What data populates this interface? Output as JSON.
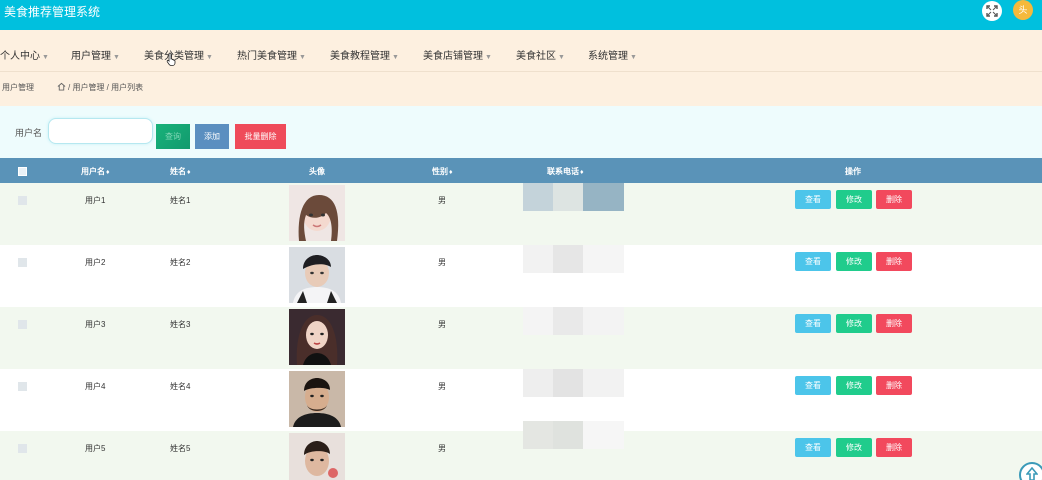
{
  "app": {
    "title": "美食推荐管理系统",
    "avatar_text": "头"
  },
  "nav": {
    "items": [
      {
        "label": "个人中心"
      },
      {
        "label": "用户管理"
      },
      {
        "label": "美食分类管理"
      },
      {
        "label": "热门美食管理"
      },
      {
        "label": "美食教程管理"
      },
      {
        "label": "美食店铺管理"
      },
      {
        "label": "美食社区"
      },
      {
        "label": "系统管理"
      }
    ]
  },
  "breadcrumb": {
    "title": "用户管理",
    "path": "/ 用户管理 / 用户列表"
  },
  "search": {
    "label": "用户名",
    "value": "",
    "placeholder": "",
    "search_button": "查询",
    "add_button": "添加",
    "batch_delete_button": "批量删除"
  },
  "table": {
    "columns": [
      "用户名",
      "姓名",
      "头像",
      "性别",
      "联系电话",
      "操作"
    ],
    "sort_icon": "♦",
    "actions": {
      "view": "查看",
      "edit": "修改",
      "delete": "删除"
    },
    "rows": [
      {
        "username": "用户1",
        "name": "姓名1",
        "gender": "男",
        "avatar": "girl-photo"
      },
      {
        "username": "用户2",
        "name": "姓名2",
        "gender": "男",
        "avatar": "boy-photo"
      },
      {
        "username": "用户3",
        "name": "姓名3",
        "gender": "男",
        "avatar": "girl-photo"
      },
      {
        "username": "用户4",
        "name": "姓名4",
        "gender": "男",
        "avatar": "man-photo"
      },
      {
        "username": "用户5",
        "name": "姓名5",
        "gender": "男",
        "avatar": "man-photo"
      }
    ]
  },
  "colors": {
    "topbar": "#00c0de",
    "nav_background": "#fdf0e0",
    "table_header": "#5a93b8",
    "view_button": "#4cc5ea",
    "edit_button": "#20cc8c",
    "delete_button": "#f2495d"
  },
  "icons": {
    "fullscreen": "fullscreen-icon",
    "home": "home-icon",
    "scroll_top": "arrow-up-icon",
    "sort": "sort-icon"
  }
}
